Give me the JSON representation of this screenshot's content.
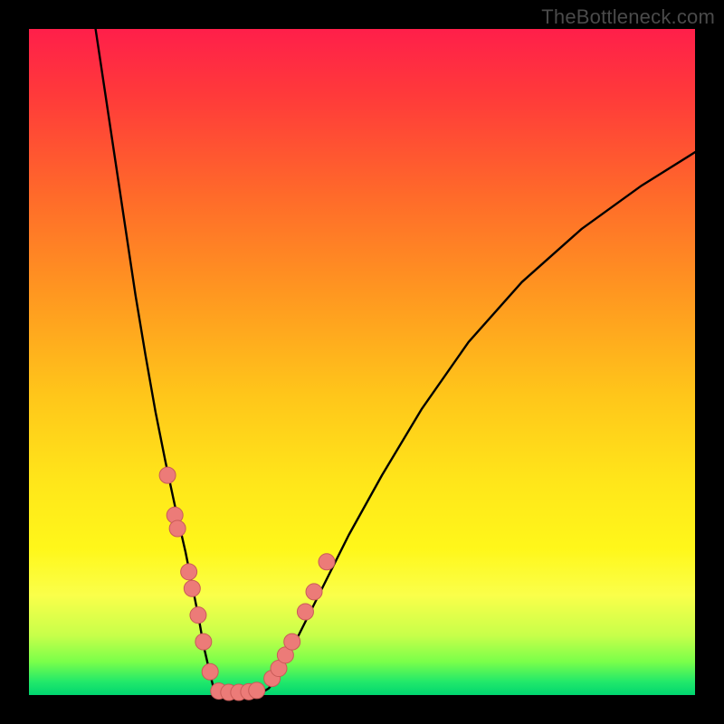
{
  "watermark": "TheBottleneck.com",
  "colors": {
    "frame": "#000000",
    "curve": "#000000",
    "dot_fill": "#ec7b78",
    "dot_stroke": "#c95b58",
    "gradient_top": "#ff1f4a",
    "gradient_bottom": "#00d670"
  },
  "chart_data": {
    "type": "line",
    "title": "",
    "xlabel": "",
    "ylabel": "",
    "xlim": [
      0,
      100
    ],
    "ylim": [
      0,
      100
    ],
    "series": [
      {
        "name": "left-curve",
        "x": [
          10.0,
          11.5,
          13.0,
          14.5,
          16.0,
          17.5,
          19.0,
          20.5,
          22.0,
          23.5,
          24.5,
          25.5,
          26.2,
          27.0,
          27.6,
          28.0
        ],
        "values": [
          100.0,
          90.0,
          80.0,
          70.0,
          60.0,
          51.0,
          42.5,
          35.0,
          28.0,
          21.5,
          16.5,
          11.5,
          7.5,
          4.0,
          1.5,
          0.2
        ]
      },
      {
        "name": "bottom-curve",
        "x": [
          28.0,
          29.0,
          30.0,
          31.0,
          32.0,
          33.0,
          34.0,
          35.0,
          36.0
        ],
        "values": [
          0.2,
          0.05,
          0.02,
          0.02,
          0.02,
          0.05,
          0.15,
          0.4,
          1.0
        ]
      },
      {
        "name": "right-curve",
        "x": [
          36.0,
          37.5,
          39.0,
          41.0,
          44.0,
          48.0,
          53.0,
          59.0,
          66.0,
          74.0,
          83.0,
          92.0,
          100.0
        ],
        "values": [
          1.0,
          3.0,
          6.0,
          10.0,
          16.0,
          24.0,
          33.0,
          43.0,
          53.0,
          62.0,
          70.0,
          76.5,
          81.5
        ]
      }
    ],
    "scatter": [
      {
        "name": "left-dots",
        "x": [
          20.8,
          21.9,
          22.3,
          24.0,
          24.5,
          25.4,
          26.2,
          27.2
        ],
        "values": [
          33.0,
          27.0,
          25.0,
          18.5,
          16.0,
          12.0,
          8.0,
          3.5
        ]
      },
      {
        "name": "bottom-dots",
        "x": [
          28.5,
          30.0,
          31.5,
          33.0,
          34.2
        ],
        "values": [
          0.6,
          0.4,
          0.4,
          0.5,
          0.7
        ]
      },
      {
        "name": "right-dots",
        "x": [
          36.5,
          37.5,
          38.5,
          39.5,
          41.5,
          42.8,
          44.7
        ],
        "values": [
          2.5,
          4.0,
          6.0,
          8.0,
          12.5,
          15.5,
          20.0
        ]
      }
    ]
  }
}
